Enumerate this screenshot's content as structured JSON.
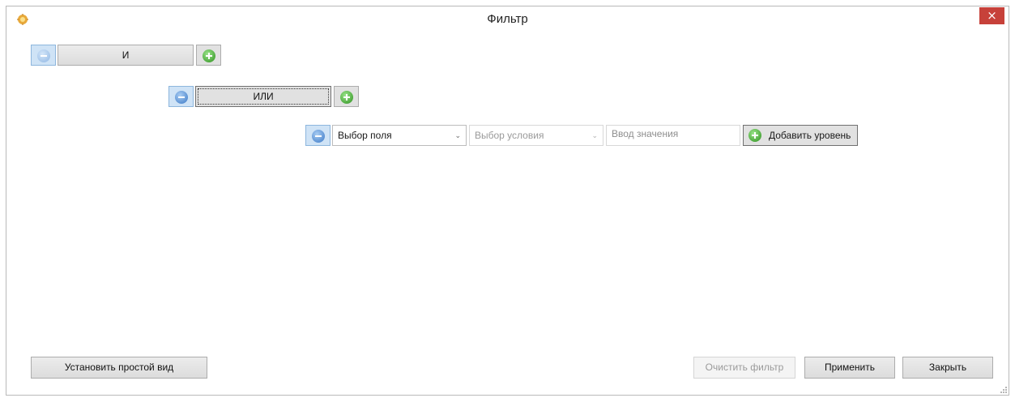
{
  "window": {
    "title": "Фильтр",
    "close_label": "×"
  },
  "level1": {
    "operator_label": "И",
    "remove_icon": "minus-circle-icon",
    "add_icon": "plus-circle-icon"
  },
  "level2": {
    "operator_label": "ИЛИ",
    "remove_icon": "minus-circle-icon",
    "add_icon": "plus-circle-icon"
  },
  "condition": {
    "field_select_value": "Выбор поля",
    "condition_select_value": "Выбор условия",
    "value_placeholder": "Ввод значения",
    "add_level_label": "Добавить уровень",
    "chevron": "⌄"
  },
  "footer": {
    "simple_view_label": "Установить простой вид",
    "clear_filter_label": "Очистить фильтр",
    "apply_label": "Применить",
    "close_label": "Закрыть"
  },
  "colors": {
    "close_button": "#c7413a",
    "minus_icon": "#3a78c6",
    "plus_icon": "#2c8f1d"
  }
}
